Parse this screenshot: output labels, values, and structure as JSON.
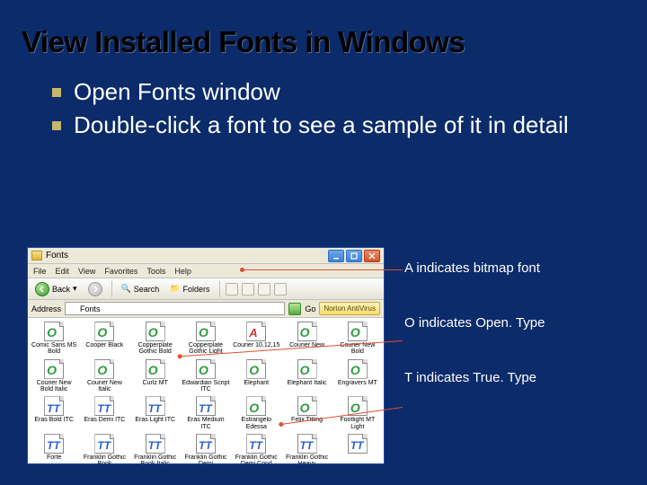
{
  "slide": {
    "title": "View Installed Fonts in Windows",
    "bullets": [
      "Open Fonts window",
      "Double-click a font to see a sample of it in detail"
    ]
  },
  "annotations": {
    "a_bitmap": "A indicates bitmap font",
    "o_opentype": "O indicates Open. Type",
    "t_truetype": "T indicates True. Type"
  },
  "window": {
    "title": "Fonts",
    "menus": [
      "File",
      "Edit",
      "View",
      "Favorites",
      "Tools",
      "Help"
    ],
    "toolbar": {
      "back": "Back",
      "search": "Search",
      "folders": "Folders"
    },
    "address": {
      "label": "Address",
      "value": "Fonts",
      "go": "Go",
      "norton": "Norton AntiVirus"
    }
  },
  "fonts": [
    {
      "type": "ot",
      "name": "Comic Sans MS Bold"
    },
    {
      "type": "ot",
      "name": "Cooper Black"
    },
    {
      "type": "ot",
      "name": "Copperplate Gothic Bold"
    },
    {
      "type": "ot",
      "name": "Copperplate Gothic Light"
    },
    {
      "type": "bm",
      "name": "Courier 10,12,15"
    },
    {
      "type": "ot",
      "name": "Courier New"
    },
    {
      "type": "ot",
      "name": "Courier New Bold"
    },
    {
      "type": "ot",
      "name": "Courier New Bold Italic"
    },
    {
      "type": "ot",
      "name": "Courier New Italic"
    },
    {
      "type": "ot",
      "name": "Curlz MT"
    },
    {
      "type": "ot",
      "name": "Edwardian Script ITC"
    },
    {
      "type": "ot",
      "name": "Elephant"
    },
    {
      "type": "ot",
      "name": "Elephant Italic"
    },
    {
      "type": "ot",
      "name": "Engravers MT"
    },
    {
      "type": "tt",
      "name": "Eras Bold ITC"
    },
    {
      "type": "tt",
      "name": "Eras Demi ITC"
    },
    {
      "type": "tt",
      "name": "Eras Light ITC"
    },
    {
      "type": "tt",
      "name": "Eras Medium ITC"
    },
    {
      "type": "ot",
      "name": "Estrangelo Edessa"
    },
    {
      "type": "ot",
      "name": "Felix Titling"
    },
    {
      "type": "ot",
      "name": "Footlight MT Light"
    },
    {
      "type": "tt",
      "name": "Forte"
    },
    {
      "type": "tt",
      "name": "Franklin Gothic Book"
    },
    {
      "type": "tt",
      "name": "Franklin Gothic Book Italic"
    },
    {
      "type": "tt",
      "name": "Franklin Gothic Demi"
    },
    {
      "type": "tt",
      "name": "Franklin Gothic Demi Cond"
    },
    {
      "type": "tt",
      "name": "Franklin Gothic Heavy"
    },
    {
      "type": "tt",
      "name": ""
    }
  ]
}
